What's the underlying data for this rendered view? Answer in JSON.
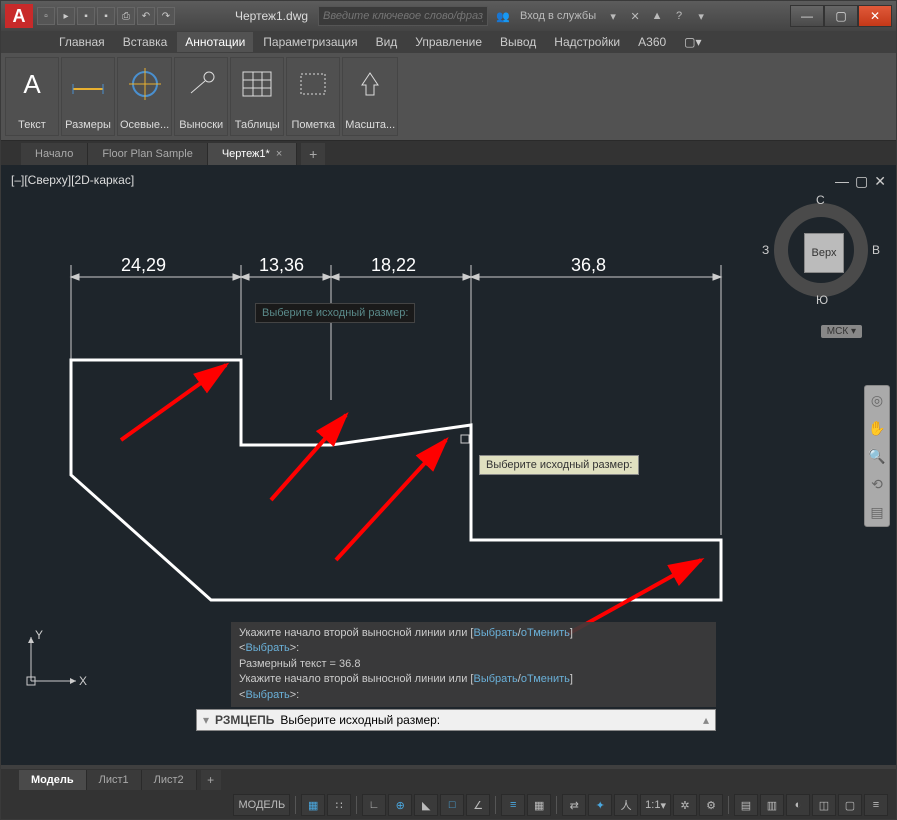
{
  "titlebar": {
    "filename": "Чертеж1.dwg",
    "search_placeholder": "Введите ключевое слово/фразу",
    "login": "Вход в службы"
  },
  "menubar": {
    "items": [
      "Главная",
      "Вставка",
      "Аннотации",
      "Параметризация",
      "Вид",
      "Управление",
      "Вывод",
      "Надстройки",
      "A360"
    ],
    "active": 2
  },
  "ribbon": {
    "panels": [
      "Текст",
      "Размеры",
      "Осевые...",
      "Выноски",
      "Таблицы",
      "Пометка",
      "Масшта..."
    ]
  },
  "filetabs": {
    "tabs": [
      "Начало",
      "Floor Plan Sample",
      "Чертеж1*"
    ],
    "active": 2
  },
  "viewport": {
    "label": "[–][Сверху][2D-каркас]"
  },
  "viewcube": {
    "face": "Верх",
    "n": "С",
    "s": "Ю",
    "e": "В",
    "w": "З",
    "mck": "МСК"
  },
  "dimensions": {
    "d1": "24,29",
    "d2": "13,36",
    "d3": "18,22",
    "d4": "36,8"
  },
  "tooltip_dark": "Выберите исходный размер:",
  "tooltip_light": "Выберите исходный размер:",
  "cmdhist": {
    "l1a": "Укажите начало второй выносной линии или [",
    "l1b": "Выбрать",
    "l1c": "/",
    "l1d": "оТменить",
    "l1e": "]",
    "l2a": "<",
    "l2b": "Выбрать",
    "l2c": ">:",
    "l3": "Размерный текст = 36.8",
    "l4a": "Укажите начало второй выносной линии или [",
    "l4b": "Выбрать",
    "l4c": "/",
    "l4d": "оТменить",
    "l4e": "]",
    "l5a": "<",
    "l5b": "Выбрать",
    "l5c": ">:"
  },
  "cmdline": {
    "cmd": "РЗМЦЕПЬ",
    "prompt": "Выберите исходный размер:"
  },
  "ucs": {
    "x": "X",
    "y": "Y"
  },
  "layouttabs": {
    "tabs": [
      "Модель",
      "Лист1",
      "Лист2"
    ],
    "active": 0
  },
  "statusbar": {
    "model": "МОДЕЛЬ",
    "scale": "1:1"
  }
}
